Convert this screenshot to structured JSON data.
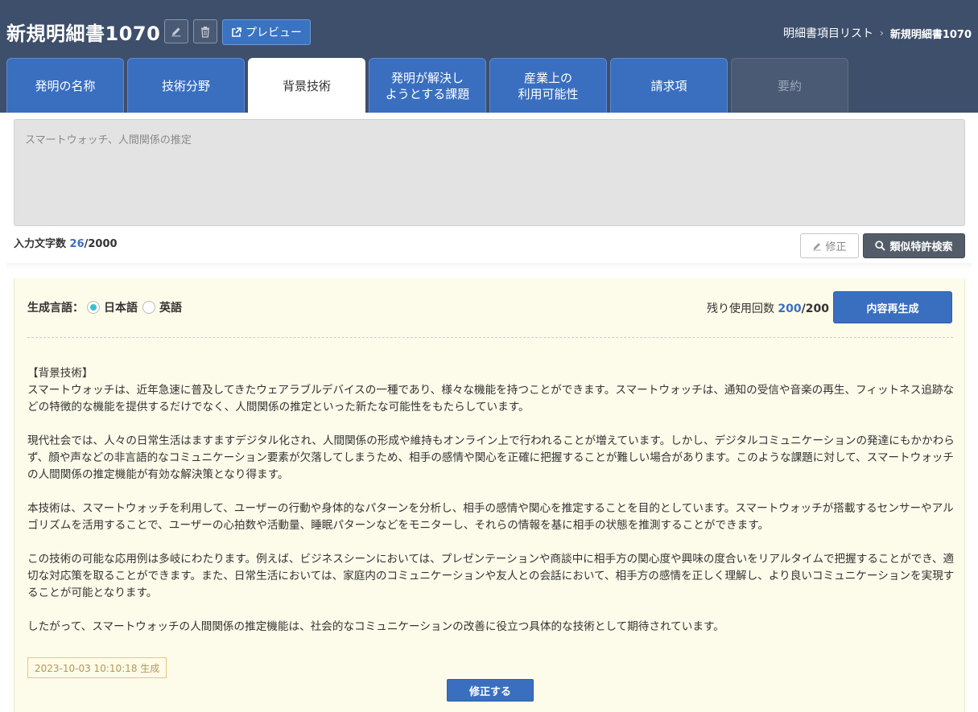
{
  "header": {
    "title": "新規明細書1070",
    "preview_label": "プレビュー",
    "breadcrumb": {
      "parent": "明細書項目リスト",
      "current": "新規明細書1070"
    }
  },
  "tabs": [
    {
      "label": "発明の名称",
      "state": "normal"
    },
    {
      "label": "技術分野",
      "state": "normal"
    },
    {
      "label": "背景技術",
      "state": "active"
    },
    {
      "label": "発明が解決し\nようとする課題",
      "state": "normal"
    },
    {
      "label": "産業上の\n利用可能性",
      "state": "normal"
    },
    {
      "label": "請求項",
      "state": "normal"
    },
    {
      "label": "要約",
      "state": "disabled"
    }
  ],
  "input": {
    "placeholder_text": "スマートウォッチ、人間関係の推定",
    "char_count_label": "入力文字数",
    "char_count": "26",
    "char_limit": "/2000",
    "fix_label": "修正",
    "similar_search_label": "類似特許検索"
  },
  "generation": {
    "lang_label": "生成言語：",
    "lang_options": [
      "日本語",
      "英語"
    ],
    "selected_lang": "日本語",
    "remaining_label": "残り使用回数",
    "remaining": "200",
    "remaining_total": "/200",
    "regenerate_label": "内容再生成",
    "paragraphs": [
      "【背景技術】\nスマートウォッチは、近年急速に普及してきたウェアラブルデバイスの一種であり、様々な機能を持つことができます。スマートウォッチは、通知の受信や音楽の再生、フィットネス追跡などの特徴的な機能を提供するだけでなく、人間関係の推定といった新たな可能性をもたらしています。",
      "現代社会では、人々の日常生活はますますデジタル化され、人間関係の形成や維持もオンライン上で行われることが増えています。しかし、デジタルコミュニケーションの発達にもかかわらず、顔や声などの非言語的なコミュニケーション要素が欠落してしまうため、相手の感情や関心を正確に把握することが難しい場合があります。このような課題に対して、スマートウォッチの人間関係の推定機能が有効な解決策となり得ます。",
      "本技術は、スマートウォッチを利用して、ユーザーの行動や身体的なパターンを分析し、相手の感情や関心を推定することを目的としています。スマートウォッチが搭載するセンサーやアルゴリズムを活用することで、ユーザーの心拍数や活動量、睡眠パターンなどをモニターし、それらの情報を基に相手の状態を推測することができます。",
      "この技術の可能な応用例は多岐にわたります。例えば、ビジネスシーンにおいては、プレゼンテーションや商談中に相手方の関心度や興味の度合いをリアルタイムで把握することができ、適切な対応策を取ることができます。また、日常生活においては、家庭内のコミュニケーションや友人との会話において、相手方の感情を正しく理解し、より良いコミュニケーションを実現することが可能となります。",
      "したがって、スマートウォッチの人間関係の推定機能は、社会的なコミュニケーションの改善に役立つ具体的な技術として期待されています。"
    ],
    "timestamp": "2023-10-03 10:10:18 生成",
    "modify_label": "修正する"
  }
}
